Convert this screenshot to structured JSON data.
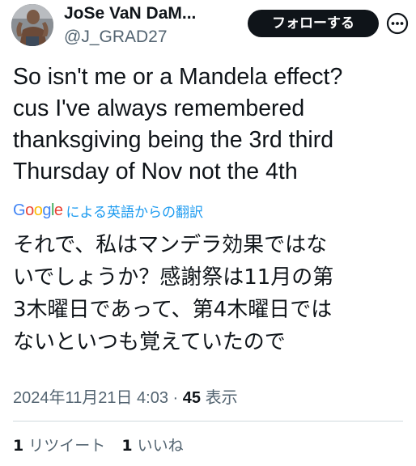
{
  "header": {
    "display_name": "JoSe VaN DaM...",
    "handle": "@J_GRAD27",
    "follow_label": "フォローする",
    "more_icon": "more-circle-icon"
  },
  "tweet": {
    "text": "So isn't me or a Mandela effect?\ncus I've always remembered\nthanksgiving being the 3rd third\nThursday of Nov not the 4th",
    "translated_by_label": "による英語からの翻訳",
    "translated_text": "それで、私はマンデラ効果ではな\nいでしょうか？感謝祭は11月の第\n3木曜日であって、第4木曜日では\nないといつも覚えていたので"
  },
  "google_logo": {
    "letters": [
      "G",
      "o",
      "o",
      "g",
      "l",
      "e"
    ],
    "colors": [
      "#4285f4",
      "#ea4335",
      "#fbbc05",
      "#4285f4",
      "#34a853",
      "#ea4335"
    ]
  },
  "meta": {
    "timestamp": "2024年11月21日 4:03",
    "separator": "·",
    "views_count": "45",
    "views_label": "表示"
  },
  "stats": {
    "retweets_count": "1",
    "retweets_label": "リツイート",
    "likes_count": "1",
    "likes_label": "いいね"
  },
  "colors": {
    "text_primary": "#0f1419",
    "text_secondary": "#536471",
    "accent": "#1d9bf0",
    "divider": "#cfd9de",
    "button_bg": "#0f1419"
  }
}
